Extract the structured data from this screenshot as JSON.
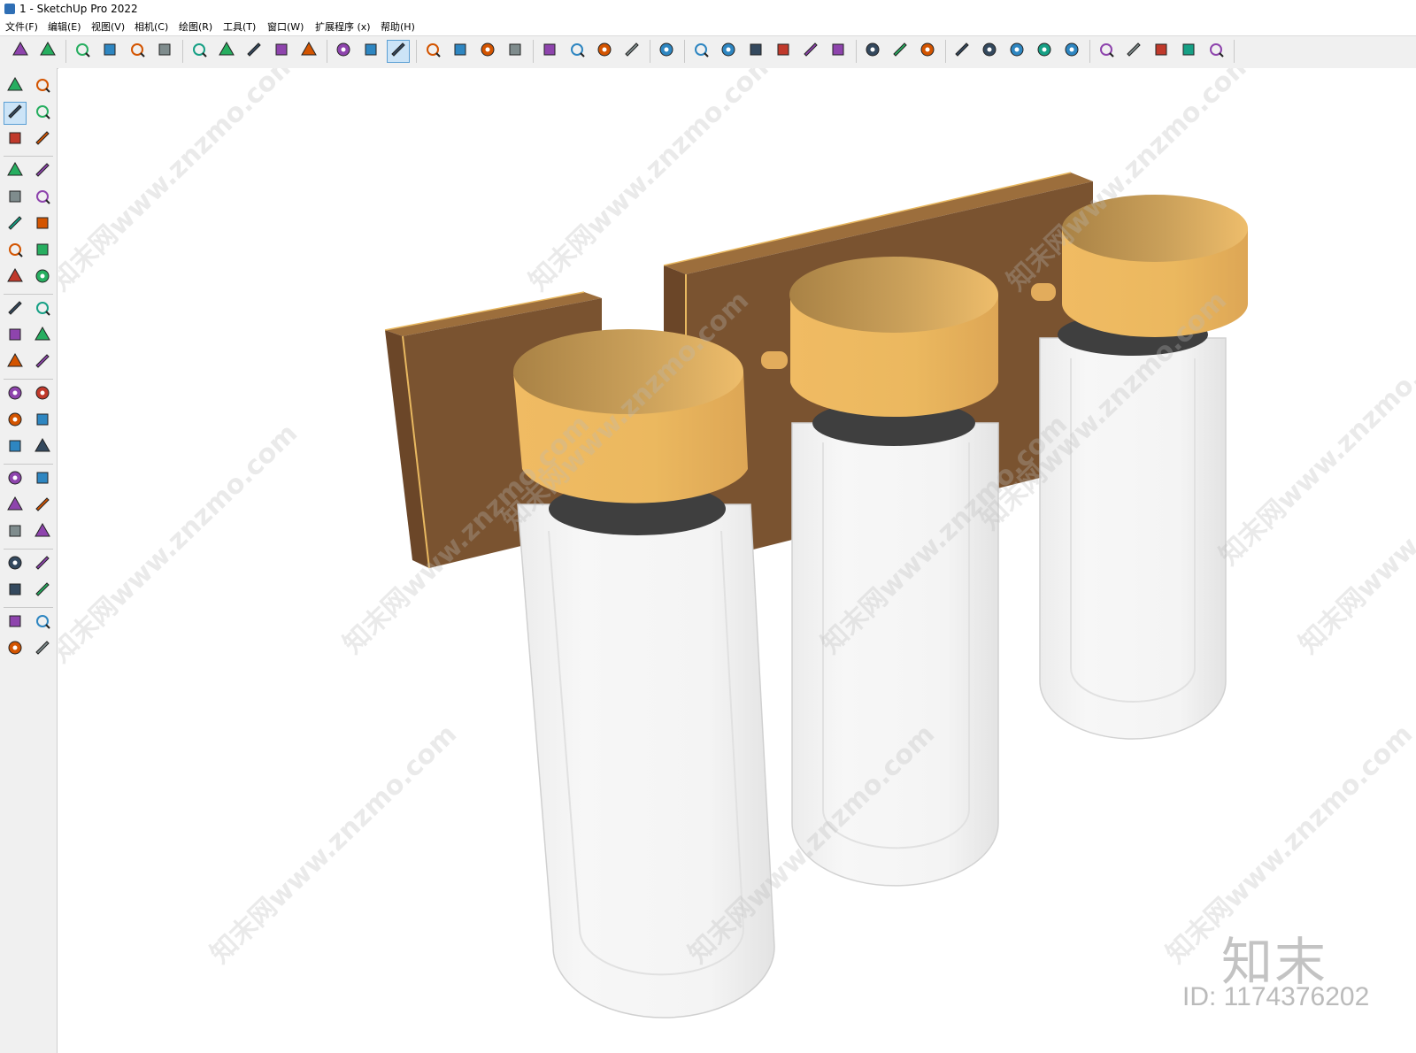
{
  "window": {
    "title": "1 - SketchUp Pro 2022"
  },
  "menu": [
    {
      "label": "文件(F)"
    },
    {
      "label": "编辑(E)"
    },
    {
      "label": "视图(V)"
    },
    {
      "label": "相机(C)"
    },
    {
      "label": "绘图(R)"
    },
    {
      "label": "工具(T)"
    },
    {
      "label": "窗口(W)"
    },
    {
      "label": "扩展程序 (x)"
    },
    {
      "label": "帮助(H)"
    }
  ],
  "toolbar": {
    "tools": [
      "zoom-icon",
      "select-icon",
      "eraser-icon",
      "pencil-icon",
      "arc-icon",
      "rectangle-icon",
      "push-pull-icon",
      "follow-me-icon",
      "move-icon",
      "rotate-icon",
      "scale-icon",
      "tape-measure-icon",
      "text-icon",
      "paint-bucket-icon",
      "orbit-icon",
      "pan-icon",
      "zoom-tool-icon",
      "zoom-extents-icon",
      "warehouse-icon",
      "extension-warehouse-icon",
      "layout-icon",
      "extension-manager-icon",
      "account-icon",
      "iso-view-icon",
      "top-view-icon",
      "front-view-icon",
      "right-view-icon",
      "back-view-icon",
      "left-view-icon",
      "solid-tools-icon",
      "section-plane-icon",
      "display-section-icon",
      "add-location-icon",
      "geo-icon",
      "terrain-icon",
      "shadow-icon",
      "cloud-icon",
      "settings-icon",
      "message-icon",
      "info-icon",
      "cart-icon",
      "user-icon"
    ],
    "active_tool": "paint-bucket-icon"
  },
  "left_toolbar": {
    "tools": [
      "select-icon",
      "orbit-icon",
      "paint-bucket-icon",
      "eraser-icon",
      "make-component-icon",
      "tag-icon",
      "line-icon",
      "freehand-icon",
      "rectangle-icon",
      "rotated-rectangle-icon",
      "circle-icon",
      "polygon-icon",
      "arc-icon",
      "two-point-arc-icon",
      "three-point-arc-icon",
      "pie-icon",
      "move-icon",
      "push-pull-icon",
      "rotate-icon",
      "follow-me-icon",
      "scale-icon",
      "offset-icon",
      "tape-measure-icon",
      "dimension-icon",
      "protractor-icon",
      "text-icon",
      "axes-icon",
      "3d-text-icon",
      "orbit-tool-icon",
      "pan-icon",
      "zoom-icon",
      "zoom-window-icon",
      "zoom-extents-icon",
      "previous-view-icon",
      "position-camera-icon",
      "look-around-icon",
      "walk-icon",
      "section-plane-icon",
      "warehouse-icon",
      "extension-warehouse-icon",
      "layout-icon",
      "extension-manager-icon"
    ],
    "active_tool": "paint-bucket-icon"
  },
  "scene": {
    "model": "three-light wall sconce",
    "colors": {
      "plate_front": "#7a5330",
      "plate_top": "#9c6e3c",
      "plate_edge": "#e8b860",
      "cap_top": "#f1c06f",
      "cap_side": "#e9b560",
      "cap_shadow": "#a27c40",
      "ring": "#4a4a4a",
      "glass": "#f2f2f2",
      "glass_edge": "#d7d7d7"
    }
  },
  "watermark": {
    "text": "知末网www.znzmo.com",
    "brand": "知末",
    "id_label": "ID: 1174376202"
  }
}
